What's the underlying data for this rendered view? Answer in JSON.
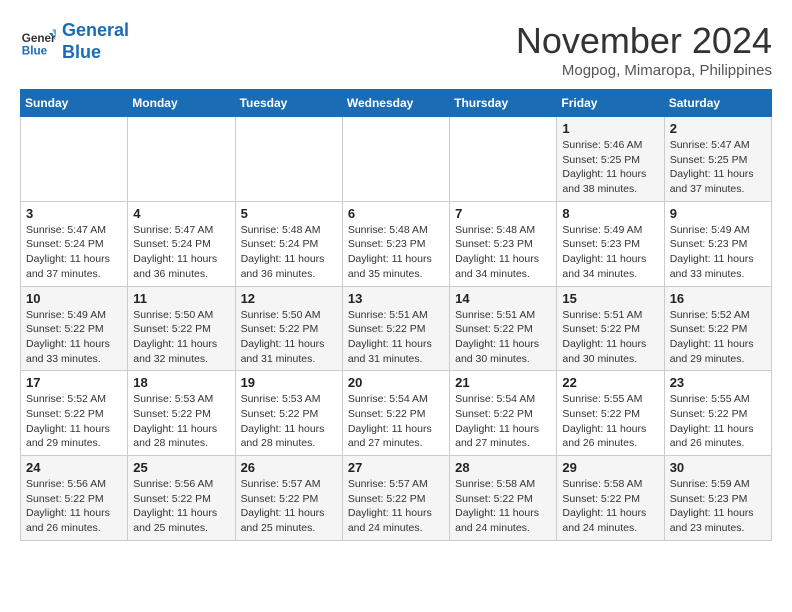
{
  "header": {
    "logo_line1": "General",
    "logo_line2": "Blue",
    "month": "November 2024",
    "location": "Mogpog, Mimaropa, Philippines"
  },
  "weekdays": [
    "Sunday",
    "Monday",
    "Tuesday",
    "Wednesday",
    "Thursday",
    "Friday",
    "Saturday"
  ],
  "weeks": [
    [
      {
        "day": "",
        "info": ""
      },
      {
        "day": "",
        "info": ""
      },
      {
        "day": "",
        "info": ""
      },
      {
        "day": "",
        "info": ""
      },
      {
        "day": "",
        "info": ""
      },
      {
        "day": "1",
        "info": "Sunrise: 5:46 AM\nSunset: 5:25 PM\nDaylight: 11 hours\nand 38 minutes."
      },
      {
        "day": "2",
        "info": "Sunrise: 5:47 AM\nSunset: 5:25 PM\nDaylight: 11 hours\nand 37 minutes."
      }
    ],
    [
      {
        "day": "3",
        "info": "Sunrise: 5:47 AM\nSunset: 5:24 PM\nDaylight: 11 hours\nand 37 minutes."
      },
      {
        "day": "4",
        "info": "Sunrise: 5:47 AM\nSunset: 5:24 PM\nDaylight: 11 hours\nand 36 minutes."
      },
      {
        "day": "5",
        "info": "Sunrise: 5:48 AM\nSunset: 5:24 PM\nDaylight: 11 hours\nand 36 minutes."
      },
      {
        "day": "6",
        "info": "Sunrise: 5:48 AM\nSunset: 5:23 PM\nDaylight: 11 hours\nand 35 minutes."
      },
      {
        "day": "7",
        "info": "Sunrise: 5:48 AM\nSunset: 5:23 PM\nDaylight: 11 hours\nand 34 minutes."
      },
      {
        "day": "8",
        "info": "Sunrise: 5:49 AM\nSunset: 5:23 PM\nDaylight: 11 hours\nand 34 minutes."
      },
      {
        "day": "9",
        "info": "Sunrise: 5:49 AM\nSunset: 5:23 PM\nDaylight: 11 hours\nand 33 minutes."
      }
    ],
    [
      {
        "day": "10",
        "info": "Sunrise: 5:49 AM\nSunset: 5:22 PM\nDaylight: 11 hours\nand 33 minutes."
      },
      {
        "day": "11",
        "info": "Sunrise: 5:50 AM\nSunset: 5:22 PM\nDaylight: 11 hours\nand 32 minutes."
      },
      {
        "day": "12",
        "info": "Sunrise: 5:50 AM\nSunset: 5:22 PM\nDaylight: 11 hours\nand 31 minutes."
      },
      {
        "day": "13",
        "info": "Sunrise: 5:51 AM\nSunset: 5:22 PM\nDaylight: 11 hours\nand 31 minutes."
      },
      {
        "day": "14",
        "info": "Sunrise: 5:51 AM\nSunset: 5:22 PM\nDaylight: 11 hours\nand 30 minutes."
      },
      {
        "day": "15",
        "info": "Sunrise: 5:51 AM\nSunset: 5:22 PM\nDaylight: 11 hours\nand 30 minutes."
      },
      {
        "day": "16",
        "info": "Sunrise: 5:52 AM\nSunset: 5:22 PM\nDaylight: 11 hours\nand 29 minutes."
      }
    ],
    [
      {
        "day": "17",
        "info": "Sunrise: 5:52 AM\nSunset: 5:22 PM\nDaylight: 11 hours\nand 29 minutes."
      },
      {
        "day": "18",
        "info": "Sunrise: 5:53 AM\nSunset: 5:22 PM\nDaylight: 11 hours\nand 28 minutes."
      },
      {
        "day": "19",
        "info": "Sunrise: 5:53 AM\nSunset: 5:22 PM\nDaylight: 11 hours\nand 28 minutes."
      },
      {
        "day": "20",
        "info": "Sunrise: 5:54 AM\nSunset: 5:22 PM\nDaylight: 11 hours\nand 27 minutes."
      },
      {
        "day": "21",
        "info": "Sunrise: 5:54 AM\nSunset: 5:22 PM\nDaylight: 11 hours\nand 27 minutes."
      },
      {
        "day": "22",
        "info": "Sunrise: 5:55 AM\nSunset: 5:22 PM\nDaylight: 11 hours\nand 26 minutes."
      },
      {
        "day": "23",
        "info": "Sunrise: 5:55 AM\nSunset: 5:22 PM\nDaylight: 11 hours\nand 26 minutes."
      }
    ],
    [
      {
        "day": "24",
        "info": "Sunrise: 5:56 AM\nSunset: 5:22 PM\nDaylight: 11 hours\nand 26 minutes."
      },
      {
        "day": "25",
        "info": "Sunrise: 5:56 AM\nSunset: 5:22 PM\nDaylight: 11 hours\nand 25 minutes."
      },
      {
        "day": "26",
        "info": "Sunrise: 5:57 AM\nSunset: 5:22 PM\nDaylight: 11 hours\nand 25 minutes."
      },
      {
        "day": "27",
        "info": "Sunrise: 5:57 AM\nSunset: 5:22 PM\nDaylight: 11 hours\nand 24 minutes."
      },
      {
        "day": "28",
        "info": "Sunrise: 5:58 AM\nSunset: 5:22 PM\nDaylight: 11 hours\nand 24 minutes."
      },
      {
        "day": "29",
        "info": "Sunrise: 5:58 AM\nSunset: 5:22 PM\nDaylight: 11 hours\nand 24 minutes."
      },
      {
        "day": "30",
        "info": "Sunrise: 5:59 AM\nSunset: 5:23 PM\nDaylight: 11 hours\nand 23 minutes."
      }
    ]
  ]
}
